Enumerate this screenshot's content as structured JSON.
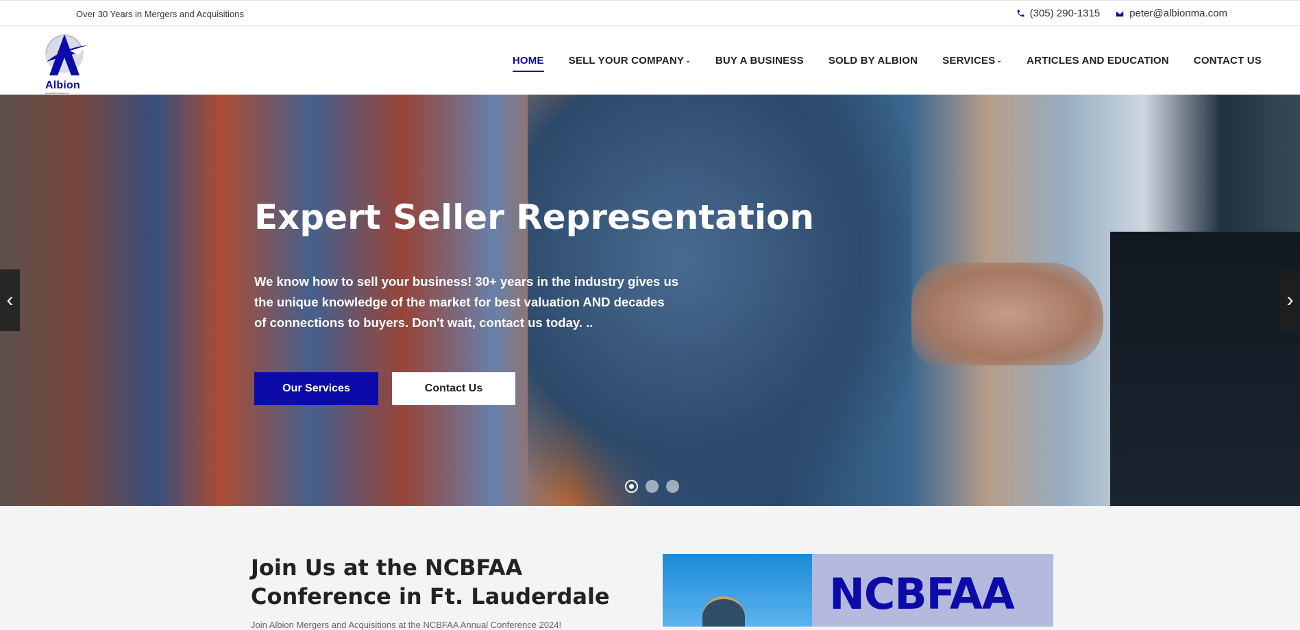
{
  "topbar": {
    "tagline": "Over 30 Years in Mergers and Acquisitions",
    "phone": "(305) 290-1315",
    "email": "peter@albionma.com"
  },
  "logo": {
    "name": "Albion",
    "subtitle": "International Services, Inc."
  },
  "nav": {
    "items": [
      {
        "label": "HOME",
        "active": true
      },
      {
        "label": "SELL YOUR COMPANY",
        "dropdown": true
      },
      {
        "label": "BUY A BUSINESS"
      },
      {
        "label": "SOLD BY ALBION"
      },
      {
        "label": "SERVICES",
        "dropdown": true
      },
      {
        "label": "ARTICLES AND EDUCATION"
      },
      {
        "label": "CONTACT US"
      }
    ]
  },
  "hero": {
    "title": "Expert Seller Representation",
    "body": "We know how to sell your business! 30+ years in the industry gives us the unique knowledge of the market for best valuation AND decades of connections to buyers. Don't wait, contact us today. ..",
    "primary_button": "Our Services",
    "secondary_button": "Contact Us",
    "slide_count": 3,
    "active_slide": 1
  },
  "section": {
    "heading": "Join Us at the NCBFAA Conference in Ft. Lauderdale",
    "teaser": "Join Albion Mergers and Acquisitions at the NCBFAA Annual Conference 2024!",
    "promo_text": "NCBFAA"
  },
  "colors": {
    "brand": "#0c0aa8",
    "section_bg": "#f4f4f5"
  },
  "icons": {
    "phone": "phone-icon",
    "email": "envelope-icon",
    "prev": "chevron-left-icon",
    "next": "chevron-right-icon"
  }
}
